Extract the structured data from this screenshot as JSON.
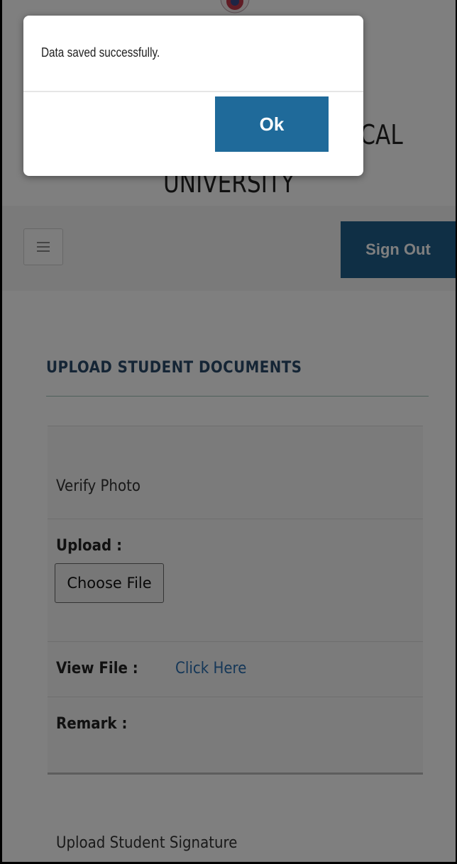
{
  "header": {
    "university_line1": "CAL",
    "university_line2": "UNIVERSITY"
  },
  "navbar": {
    "menu_icon": "hamburger-icon",
    "sign_out_label": "Sign Out",
    "accent_color": "#1f5f8b"
  },
  "main": {
    "section_title": "UPLOAD STUDENT DOCUMENTS",
    "panel": {
      "heading": "Verify Photo",
      "upload_label": "Upload :",
      "choose_file_label": "Choose File",
      "view_file_label": "View File :",
      "view_file_link": "Click Here",
      "remark_label": "Remark :"
    },
    "next_section_heading": "Upload Student Signature"
  },
  "dialog": {
    "message": "Data saved successfully.",
    "ok_label": "Ok"
  }
}
